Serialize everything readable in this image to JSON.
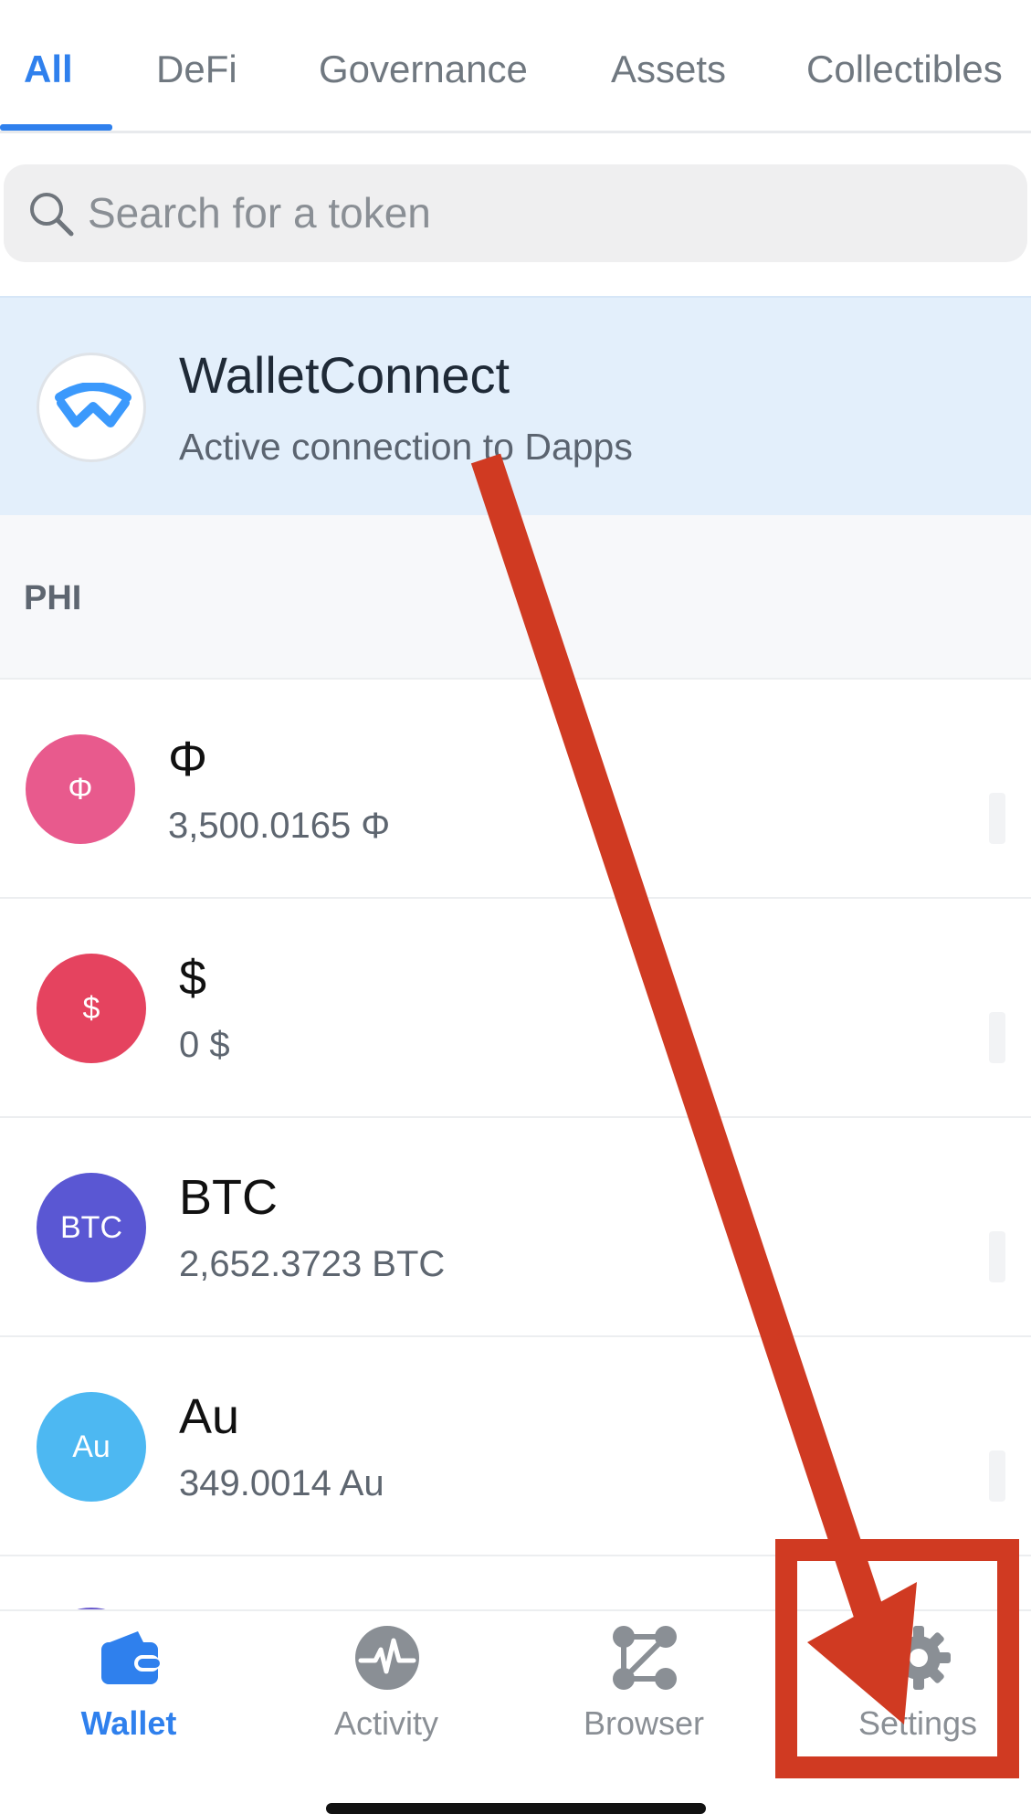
{
  "tabs": [
    {
      "label": "All",
      "active": true
    },
    {
      "label": "DeFi",
      "active": false
    },
    {
      "label": "Governance",
      "active": false
    },
    {
      "label": "Assets",
      "active": false
    },
    {
      "label": "Collectibles",
      "active": false
    }
  ],
  "search": {
    "placeholder": "Search for a token",
    "value": ""
  },
  "walletconnect": {
    "title": "WalletConnect",
    "subtitle": "Active connection to Dapps"
  },
  "section": {
    "title": "PHI"
  },
  "tokens": [
    {
      "symbol_icon": "Φ",
      "name": "Φ",
      "balance": "3,500.0165 Φ",
      "color": "#e85a8d"
    },
    {
      "symbol_icon": "$",
      "name": "$",
      "balance": "0 $",
      "color": "#e5435f"
    },
    {
      "symbol_icon": "BTC",
      "name": "BTC",
      "balance": "2,652.3723 BTC",
      "color": "#5a57d3"
    },
    {
      "symbol_icon": "Au",
      "name": "Au",
      "balance": "349.0014 Au",
      "color": "#4db8f2"
    }
  ],
  "bottom_nav": [
    {
      "label": "Wallet",
      "icon": "wallet-icon",
      "active": true
    },
    {
      "label": "Activity",
      "icon": "activity-icon",
      "active": false
    },
    {
      "label": "Browser",
      "icon": "browser-icon",
      "active": false
    },
    {
      "label": "Settings",
      "icon": "gear-icon",
      "active": false
    }
  ],
  "colors": {
    "accent": "#2f80ed",
    "annotation": "#d03a22"
  }
}
